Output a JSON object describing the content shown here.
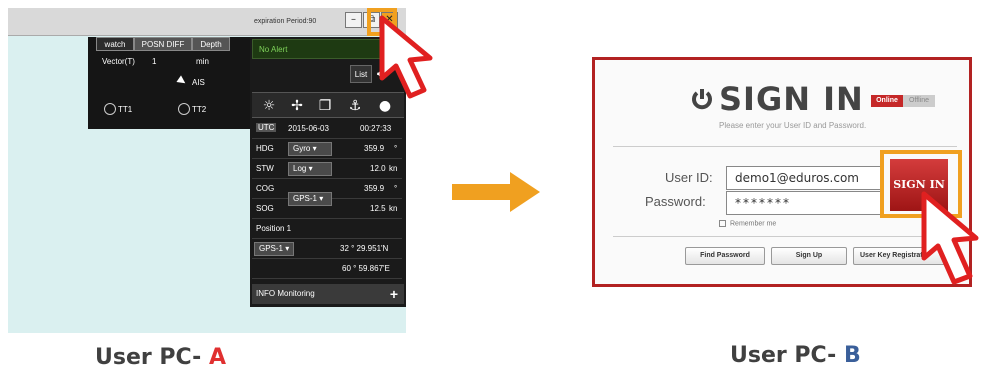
{
  "pc_a": {
    "label_prefix": "User PC- ",
    "label_letter": "A",
    "expiration": "expiration Period:90",
    "window_buttons": {
      "minimize": "–",
      "restore": "⧉",
      "close": "✕"
    },
    "tabs": [
      "watch",
      "POSN DIFF",
      "Depth"
    ],
    "vector_label": "Vector(T)",
    "vector_value": "1",
    "vector_unit": "min",
    "ais_label": "AIS",
    "tt1": "TT1",
    "tt2": "TT2",
    "alert": "No Alert",
    "list_label": "List",
    "utc_label": "UTC",
    "utc_date": "2015-06-03",
    "utc_time": "00:27:33",
    "hdg_label": "HDG",
    "hdg_source": "Gyro",
    "hdg_value": "359.9",
    "hdg_unit": "°",
    "stw_label": "STW",
    "stw_source": "Log",
    "stw_value": "12.0",
    "stw_unit": "kn",
    "cog_label": "COG",
    "cog_value": "359.9",
    "cog_unit": "°",
    "sog_label": "SOG",
    "sog_source": "GPS-1",
    "sog_value": "12.5",
    "sog_unit": "kn",
    "position_label": "Position 1",
    "pos_source": "GPS-1",
    "lat": "32 ° 29.951'N",
    "lon": "60 ° 59.867'E",
    "info_monitoring": "INFO Monitoring",
    "info_plus": "+"
  },
  "pc_b": {
    "label_prefix": "User PC- ",
    "label_letter": "B",
    "title": "SIGN IN",
    "subtitle": "Please enter your User ID and Password.",
    "online": "Online",
    "offline": "Offline",
    "user_id_label": "User ID:",
    "user_id_value": "demo1@eduros.com",
    "password_label": "Password:",
    "password_value": "*******",
    "sign_in_button": "SIGN IN",
    "remember_me": "Remember me",
    "find_password": "Find Password",
    "sign_up": "Sign Up",
    "user_key": "User Key Registrati"
  },
  "colors": {
    "highlight": "#f0a020",
    "arrow": "#f0a020",
    "cursor_red": "#e02020",
    "label_a": "#e03030",
    "label_b": "#3a5f9a"
  }
}
